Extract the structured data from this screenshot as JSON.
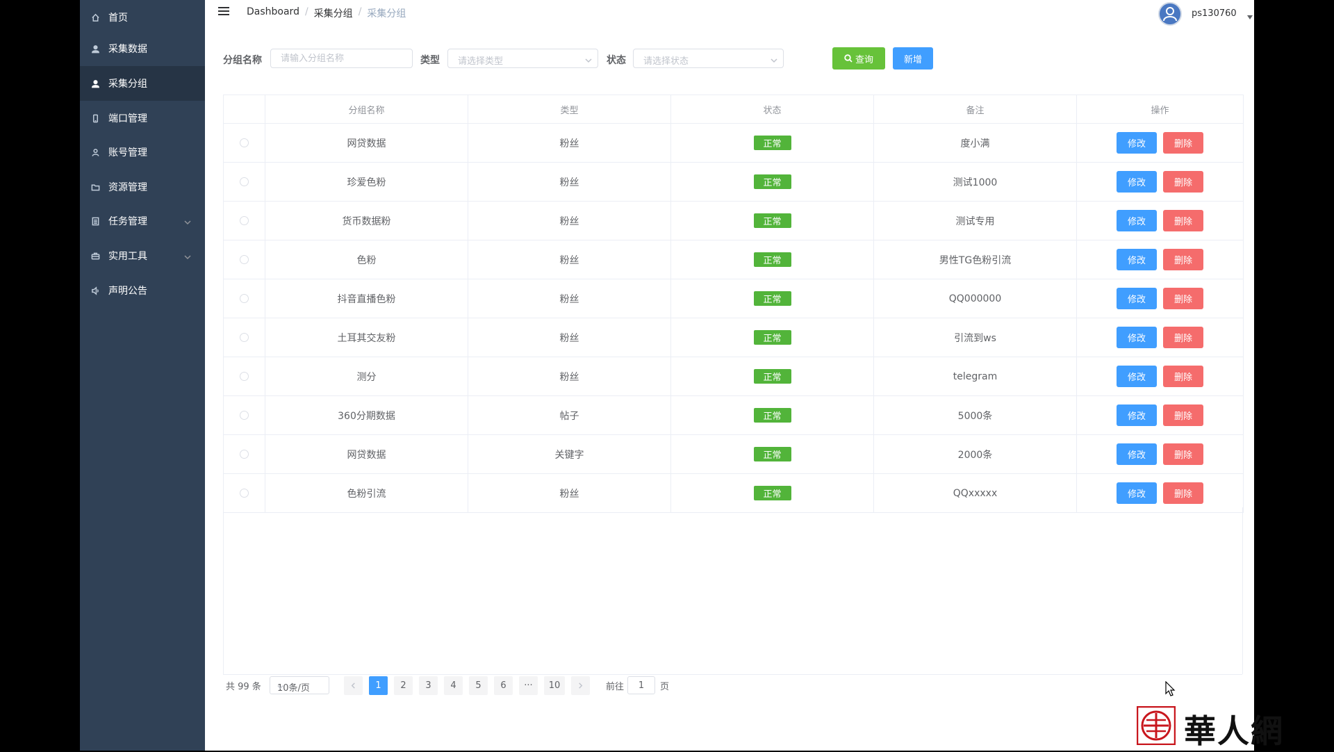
{
  "sidebar": {
    "items": [
      {
        "label": "首页",
        "icon": "home-icon"
      },
      {
        "label": "采集数据",
        "icon": "user-icon"
      },
      {
        "label": "采集分组",
        "icon": "user-icon",
        "active": true
      },
      {
        "label": "端口管理",
        "icon": "phone-icon"
      },
      {
        "label": "账号管理",
        "icon": "user-outline-icon"
      },
      {
        "label": "资源管理",
        "icon": "folder-icon"
      },
      {
        "label": "任务管理",
        "icon": "document-icon",
        "has_submenu": true
      },
      {
        "label": "实用工具",
        "icon": "tools-icon",
        "has_submenu": true
      },
      {
        "label": "声明公告",
        "icon": "speaker-icon"
      }
    ]
  },
  "navbar": {
    "breadcrumb": [
      "Dashboard",
      "采集分组",
      "采集分组"
    ],
    "username": "ps130760"
  },
  "search": {
    "group_label": "分组名称",
    "group_placeholder": "请输入分组名称",
    "type_label": "类型",
    "type_placeholder": "请选择类型",
    "status_label": "状态",
    "status_placeholder": "请选择状态",
    "query_button": "查询",
    "add_button": "新增"
  },
  "table": {
    "headers": [
      "分组名称",
      "类型",
      "状态",
      "备注",
      "操作"
    ],
    "edit_label": "修改",
    "delete_label": "删除",
    "rows": [
      {
        "name": "网贷数据",
        "type": "粉丝",
        "status": "正常",
        "remark": "度小满"
      },
      {
        "name": "珍爱色粉",
        "type": "粉丝",
        "status": "正常",
        "remark": "测试1000"
      },
      {
        "name": "货币数据粉",
        "type": "粉丝",
        "status": "正常",
        "remark": "测试专用"
      },
      {
        "name": "色粉",
        "type": "粉丝",
        "status": "正常",
        "remark": "男性TG色粉引流"
      },
      {
        "name": "抖音直播色粉",
        "type": "粉丝",
        "status": "正常",
        "remark": "QQ000000"
      },
      {
        "name": "土耳其交友粉",
        "type": "粉丝",
        "status": "正常",
        "remark": "引流到ws"
      },
      {
        "name": "测分",
        "type": "粉丝",
        "status": "正常",
        "remark": "telegram"
      },
      {
        "name": "360分期数据",
        "type": "帖子",
        "status": "正常",
        "remark": "5000条"
      },
      {
        "name": "网贷数据",
        "type": "关键字",
        "status": "正常",
        "remark": "2000条"
      },
      {
        "name": "色粉引流",
        "type": "粉丝",
        "status": "正常",
        "remark": "QQxxxxx"
      }
    ]
  },
  "pagination": {
    "total": "共 99 条",
    "page_size": "10条/页",
    "pages": [
      "1",
      "2",
      "3",
      "4",
      "5",
      "6",
      "···",
      "10"
    ],
    "current_page": "1",
    "goto_label": "前往",
    "goto_value": "1",
    "page_suffix": "页"
  },
  "watermark": {
    "logo_text": "華人網"
  },
  "colors": {
    "sidebar_bg": "#304156",
    "sidebar_active_bg": "#263445",
    "primary": "#409eff",
    "success": "#67c23a",
    "status_tag": "#52b43a",
    "danger": "#f56c6c"
  }
}
